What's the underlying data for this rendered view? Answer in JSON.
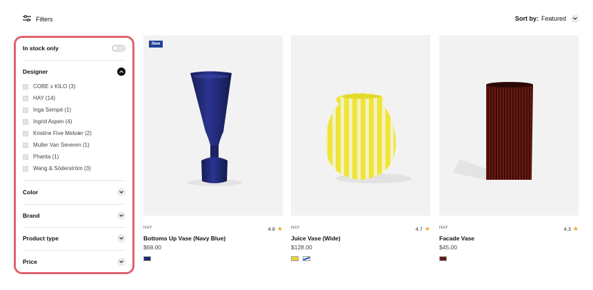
{
  "toolbar": {
    "filters_label": "Filters",
    "sort_label": "Sort by:",
    "sort_value": "Featured"
  },
  "sidebar": {
    "in_stock": {
      "label": "In stock only",
      "enabled": false
    },
    "designer": {
      "title": "Designer",
      "options": [
        "COBE x KILO (3)",
        "HAY (14)",
        "Inga Sempé (1)",
        "Ingrid Aspen (4)",
        "Kristine Five Melvær (2)",
        "Muller Van Severen (1)",
        "Phanta (1)",
        "Wang & Söderström (3)"
      ]
    },
    "color_title": "Color",
    "brand_title": "Brand",
    "product_type_title": "Product type",
    "price_title": "Price"
  },
  "products": [
    {
      "badge": "New",
      "brand": "HAY",
      "rating": "4.8",
      "name": "Bottoms Up Vase (Navy Blue)",
      "price": "$68.00",
      "swatches": [
        "#1d2a6b"
      ]
    },
    {
      "badge": "",
      "brand": "HAY",
      "rating": "4.7",
      "name": "Juice Vase (Wide)",
      "price": "$128.00",
      "swatches": [
        "#f0d62a",
        "#2b66b8"
      ]
    },
    {
      "badge": "",
      "brand": "HAY",
      "rating": "4.3",
      "name": "Facade Vase",
      "price": "$45.00",
      "swatches": [
        "#6a1812"
      ]
    }
  ],
  "colors": {
    "sidebar_border": "#e0626c",
    "badge_bg": "#1e3f96",
    "star": "#f2a31c"
  }
}
